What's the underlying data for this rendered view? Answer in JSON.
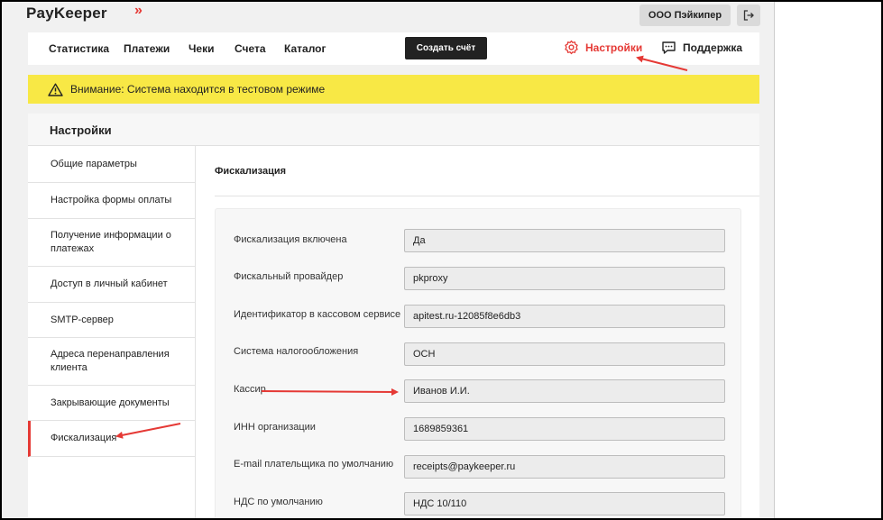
{
  "header": {
    "logo": "PayKeeper",
    "logo_mark": "»",
    "org_button": "ООО Пэйкипер",
    "logout_icon": "logout-icon"
  },
  "nav": {
    "items": [
      "Статистика",
      "Платежи",
      "Чеки",
      "Счета",
      "Каталог"
    ],
    "create_invoice": "Создать счёт",
    "settings": "Настройки",
    "settings_icon": "gear-icon",
    "support": "Поддержка",
    "support_icon": "chat-icon"
  },
  "warning": {
    "icon": "warning-icon",
    "text": "Внимание: Система находится в тестовом режиме"
  },
  "settings": {
    "title": "Настройки",
    "menu": [
      "Общие параметры",
      "Настройка формы оплаты",
      "Получение информации о платежах",
      "Доступ в личный кабинет",
      "SMTP-сервер",
      "Адреса перенаправления клиента",
      "Закрывающие документы",
      "Фискализация"
    ],
    "active_menu_item": "Фискализация"
  },
  "fiscal": {
    "title": "Фискализация",
    "fields": [
      {
        "label": "Фискализация включена",
        "value": "Да"
      },
      {
        "label": "Фискальный провайдер",
        "value": "pkproxy"
      },
      {
        "label": "Идентификатор в кассовом сервисе",
        "value": "apitest.ru-12085f8e6db3"
      },
      {
        "label": "Система налогообложения",
        "value": "ОСН"
      },
      {
        "label": "Кассир",
        "value": "Иванов И.И."
      },
      {
        "label": "ИНН организации",
        "value": "1689859361"
      },
      {
        "label": "E-mail плательщика по умолчанию",
        "value": "receipts@paykeeper.ru"
      },
      {
        "label": "НДС по умолчанию",
        "value": "НДС 10/110"
      }
    ]
  },
  "colors": {
    "accent": "#e53935",
    "warning_bg": "#f8e845",
    "dark_button": "#222222",
    "annotation_arrow": "#e53935"
  }
}
